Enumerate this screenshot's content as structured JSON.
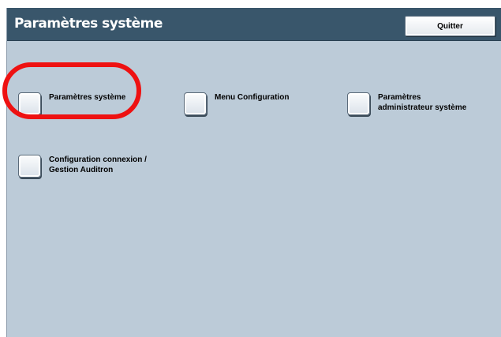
{
  "header": {
    "title": "Paramètres système",
    "quit_label": "Quitter"
  },
  "options": [
    {
      "label": "Paramètres système",
      "selected": false
    },
    {
      "label": "Menu Configuration",
      "selected": false
    },
    {
      "label": "Paramètres\nadministrateur système",
      "selected": false
    },
    {
      "label": "Configuration connexion /\nGestion Auditron",
      "selected": false
    }
  ],
  "colors": {
    "title_bar": "#39566b",
    "background": "#bccbd8",
    "highlight": "#ee1111"
  },
  "icons": {
    "option_checkbox": "square-checkbox-icon"
  }
}
